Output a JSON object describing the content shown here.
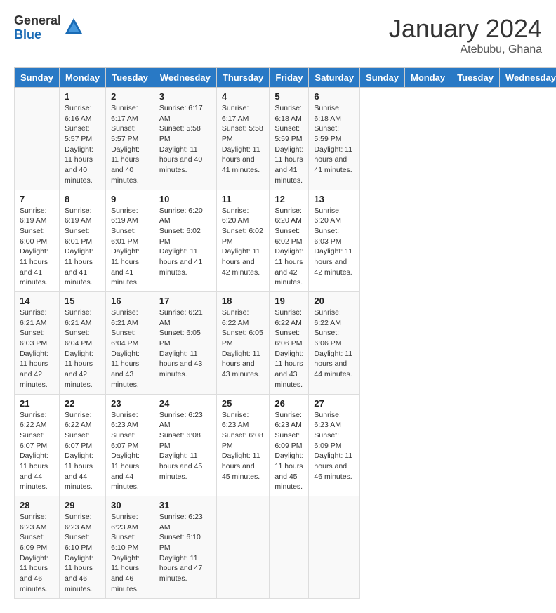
{
  "header": {
    "logo_general": "General",
    "logo_blue": "Blue",
    "month_year": "January 2024",
    "location": "Atebubu, Ghana"
  },
  "days_of_week": [
    "Sunday",
    "Monday",
    "Tuesday",
    "Wednesday",
    "Thursday",
    "Friday",
    "Saturday"
  ],
  "weeks": [
    [
      {
        "day": "",
        "sunrise": "",
        "sunset": "",
        "daylight": ""
      },
      {
        "day": "1",
        "sunrise": "Sunrise: 6:16 AM",
        "sunset": "Sunset: 5:57 PM",
        "daylight": "Daylight: 11 hours and 40 minutes."
      },
      {
        "day": "2",
        "sunrise": "Sunrise: 6:17 AM",
        "sunset": "Sunset: 5:57 PM",
        "daylight": "Daylight: 11 hours and 40 minutes."
      },
      {
        "day": "3",
        "sunrise": "Sunrise: 6:17 AM",
        "sunset": "Sunset: 5:58 PM",
        "daylight": "Daylight: 11 hours and 40 minutes."
      },
      {
        "day": "4",
        "sunrise": "Sunrise: 6:17 AM",
        "sunset": "Sunset: 5:58 PM",
        "daylight": "Daylight: 11 hours and 41 minutes."
      },
      {
        "day": "5",
        "sunrise": "Sunrise: 6:18 AM",
        "sunset": "Sunset: 5:59 PM",
        "daylight": "Daylight: 11 hours and 41 minutes."
      },
      {
        "day": "6",
        "sunrise": "Sunrise: 6:18 AM",
        "sunset": "Sunset: 5:59 PM",
        "daylight": "Daylight: 11 hours and 41 minutes."
      }
    ],
    [
      {
        "day": "7",
        "sunrise": "Sunrise: 6:19 AM",
        "sunset": "Sunset: 6:00 PM",
        "daylight": "Daylight: 11 hours and 41 minutes."
      },
      {
        "day": "8",
        "sunrise": "Sunrise: 6:19 AM",
        "sunset": "Sunset: 6:01 PM",
        "daylight": "Daylight: 11 hours and 41 minutes."
      },
      {
        "day": "9",
        "sunrise": "Sunrise: 6:19 AM",
        "sunset": "Sunset: 6:01 PM",
        "daylight": "Daylight: 11 hours and 41 minutes."
      },
      {
        "day": "10",
        "sunrise": "Sunrise: 6:20 AM",
        "sunset": "Sunset: 6:02 PM",
        "daylight": "Daylight: 11 hours and 41 minutes."
      },
      {
        "day": "11",
        "sunrise": "Sunrise: 6:20 AM",
        "sunset": "Sunset: 6:02 PM",
        "daylight": "Daylight: 11 hours and 42 minutes."
      },
      {
        "day": "12",
        "sunrise": "Sunrise: 6:20 AM",
        "sunset": "Sunset: 6:02 PM",
        "daylight": "Daylight: 11 hours and 42 minutes."
      },
      {
        "day": "13",
        "sunrise": "Sunrise: 6:20 AM",
        "sunset": "Sunset: 6:03 PM",
        "daylight": "Daylight: 11 hours and 42 minutes."
      }
    ],
    [
      {
        "day": "14",
        "sunrise": "Sunrise: 6:21 AM",
        "sunset": "Sunset: 6:03 PM",
        "daylight": "Daylight: 11 hours and 42 minutes."
      },
      {
        "day": "15",
        "sunrise": "Sunrise: 6:21 AM",
        "sunset": "Sunset: 6:04 PM",
        "daylight": "Daylight: 11 hours and 42 minutes."
      },
      {
        "day": "16",
        "sunrise": "Sunrise: 6:21 AM",
        "sunset": "Sunset: 6:04 PM",
        "daylight": "Daylight: 11 hours and 43 minutes."
      },
      {
        "day": "17",
        "sunrise": "Sunrise: 6:21 AM",
        "sunset": "Sunset: 6:05 PM",
        "daylight": "Daylight: 11 hours and 43 minutes."
      },
      {
        "day": "18",
        "sunrise": "Sunrise: 6:22 AM",
        "sunset": "Sunset: 6:05 PM",
        "daylight": "Daylight: 11 hours and 43 minutes."
      },
      {
        "day": "19",
        "sunrise": "Sunrise: 6:22 AM",
        "sunset": "Sunset: 6:06 PM",
        "daylight": "Daylight: 11 hours and 43 minutes."
      },
      {
        "day": "20",
        "sunrise": "Sunrise: 6:22 AM",
        "sunset": "Sunset: 6:06 PM",
        "daylight": "Daylight: 11 hours and 44 minutes."
      }
    ],
    [
      {
        "day": "21",
        "sunrise": "Sunrise: 6:22 AM",
        "sunset": "Sunset: 6:07 PM",
        "daylight": "Daylight: 11 hours and 44 minutes."
      },
      {
        "day": "22",
        "sunrise": "Sunrise: 6:22 AM",
        "sunset": "Sunset: 6:07 PM",
        "daylight": "Daylight: 11 hours and 44 minutes."
      },
      {
        "day": "23",
        "sunrise": "Sunrise: 6:23 AM",
        "sunset": "Sunset: 6:07 PM",
        "daylight": "Daylight: 11 hours and 44 minutes."
      },
      {
        "day": "24",
        "sunrise": "Sunrise: 6:23 AM",
        "sunset": "Sunset: 6:08 PM",
        "daylight": "Daylight: 11 hours and 45 minutes."
      },
      {
        "day": "25",
        "sunrise": "Sunrise: 6:23 AM",
        "sunset": "Sunset: 6:08 PM",
        "daylight": "Daylight: 11 hours and 45 minutes."
      },
      {
        "day": "26",
        "sunrise": "Sunrise: 6:23 AM",
        "sunset": "Sunset: 6:09 PM",
        "daylight": "Daylight: 11 hours and 45 minutes."
      },
      {
        "day": "27",
        "sunrise": "Sunrise: 6:23 AM",
        "sunset": "Sunset: 6:09 PM",
        "daylight": "Daylight: 11 hours and 46 minutes."
      }
    ],
    [
      {
        "day": "28",
        "sunrise": "Sunrise: 6:23 AM",
        "sunset": "Sunset: 6:09 PM",
        "daylight": "Daylight: 11 hours and 46 minutes."
      },
      {
        "day": "29",
        "sunrise": "Sunrise: 6:23 AM",
        "sunset": "Sunset: 6:10 PM",
        "daylight": "Daylight: 11 hours and 46 minutes."
      },
      {
        "day": "30",
        "sunrise": "Sunrise: 6:23 AM",
        "sunset": "Sunset: 6:10 PM",
        "daylight": "Daylight: 11 hours and 46 minutes."
      },
      {
        "day": "31",
        "sunrise": "Sunrise: 6:23 AM",
        "sunset": "Sunset: 6:10 PM",
        "daylight": "Daylight: 11 hours and 47 minutes."
      },
      {
        "day": "",
        "sunrise": "",
        "sunset": "",
        "daylight": ""
      },
      {
        "day": "",
        "sunrise": "",
        "sunset": "",
        "daylight": ""
      },
      {
        "day": "",
        "sunrise": "",
        "sunset": "",
        "daylight": ""
      }
    ]
  ]
}
